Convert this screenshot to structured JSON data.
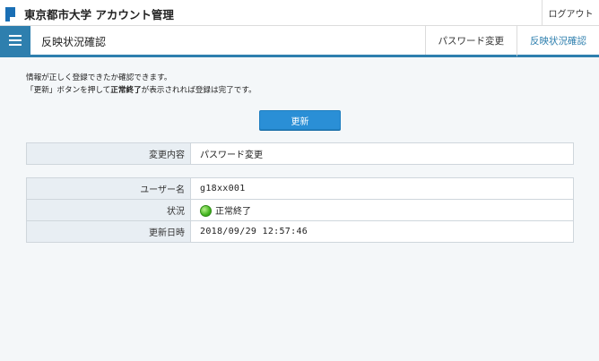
{
  "header": {
    "app_title": "東京都市大学 アカウント管理",
    "logout_label": "ログアウト"
  },
  "nav": {
    "page_title": "反映状況確認",
    "tabs": [
      {
        "label": "パスワード変更",
        "active": false
      },
      {
        "label": "反映状況確認",
        "active": true
      }
    ]
  },
  "description": {
    "line1": "情報が正しく登録できたか確認できます。",
    "line2_pre": "「更新」ボタンを押して",
    "line2_strong": "正常終了",
    "line2_post": "が表示されれば登録は完了です。"
  },
  "update_button_label": "更新",
  "change_table": {
    "label": "変更内容",
    "value": "パスワード変更"
  },
  "status_table": {
    "user_label": "ユーザー名",
    "user_value": "g18xx001",
    "status_label": "状況",
    "status_value": "正常終了",
    "status_icon": "green-circle-icon",
    "updated_label": "更新日時",
    "updated_value": "2018/09/29 12:57:46"
  },
  "colors": {
    "accent": "#2e7fae",
    "button": "#2a8fd6",
    "brand": "#1a6fb5",
    "ok_green": "#43b51f"
  }
}
